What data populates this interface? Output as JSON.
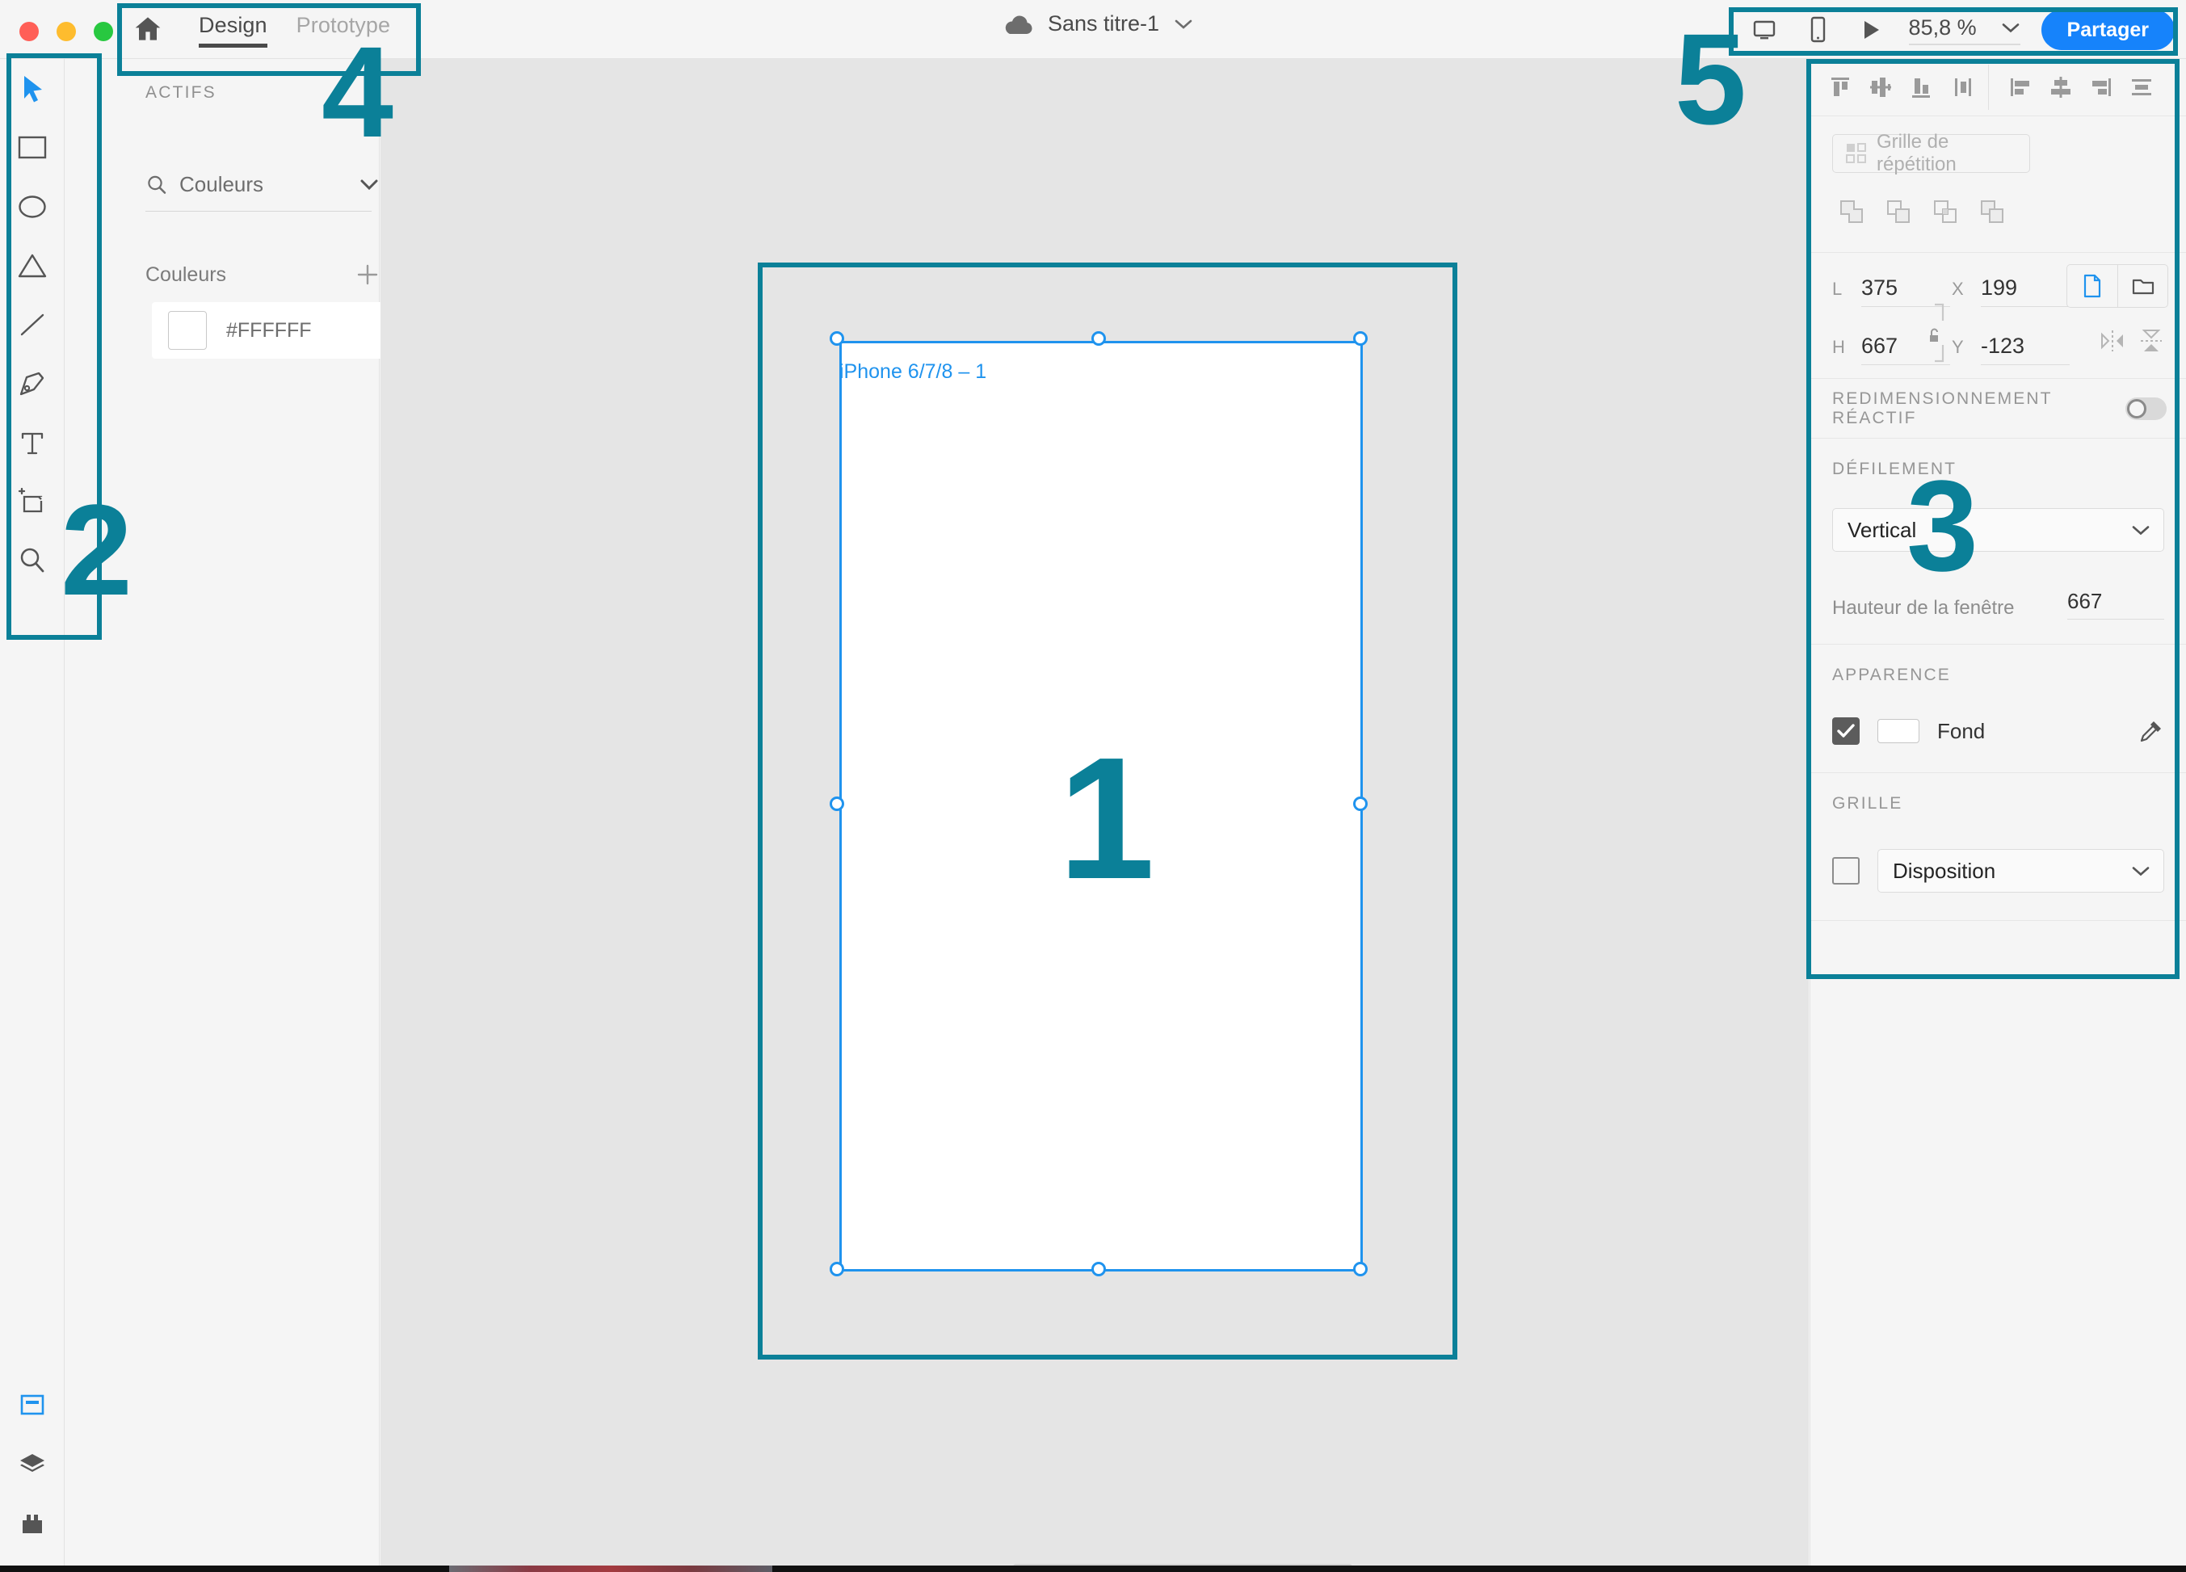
{
  "window": {
    "traffic_lights": [
      "close",
      "minimize",
      "zoom"
    ]
  },
  "topbar": {
    "home_icon": "home-icon",
    "tabs": [
      {
        "label": "Design",
        "active": true
      },
      {
        "label": "Prototype",
        "active": false
      }
    ],
    "document": {
      "cloud_icon": "cloud-icon",
      "title": "Sans titre-1",
      "chevron_icon": "chevron-down-icon"
    },
    "right_controls": {
      "desktop_preview_icon": "desktop-preview-icon",
      "mobile_preview_icon": "mobile-preview-icon",
      "play_icon": "play-icon",
      "zoom_value": "85,8 %",
      "zoom_chevron_icon": "chevron-down-icon",
      "share_label": "Partager"
    }
  },
  "left_toolbar": {
    "tools": [
      {
        "name": "select-tool",
        "icon": "cursor-icon",
        "active": true
      },
      {
        "name": "rectangle-tool",
        "icon": "rectangle-icon",
        "active": false
      },
      {
        "name": "ellipse-tool",
        "icon": "ellipse-icon",
        "active": false
      },
      {
        "name": "polygon-tool",
        "icon": "triangle-icon",
        "active": false
      },
      {
        "name": "line-tool",
        "icon": "line-icon",
        "active": false
      },
      {
        "name": "pen-tool",
        "icon": "pen-icon",
        "active": false
      },
      {
        "name": "text-tool",
        "icon": "text-icon",
        "active": false
      },
      {
        "name": "artboard-tool",
        "icon": "artboard-icon",
        "active": false
      },
      {
        "name": "zoom-tool",
        "icon": "magnifier-icon",
        "active": false
      }
    ],
    "bottom_tools": [
      {
        "name": "assets-panel-toggle",
        "icon": "assets-panel-icon",
        "active": true
      },
      {
        "name": "layers-panel-toggle",
        "icon": "layers-icon",
        "active": false
      },
      {
        "name": "plugins-panel-toggle",
        "icon": "plugin-icon",
        "active": false
      }
    ]
  },
  "assets_panel": {
    "title": "ACTIFS",
    "search": {
      "icon": "search-icon",
      "value": "Couleurs",
      "chevron_icon": "chevron-down-icon"
    },
    "grid_view_icon": "grid-view-icon",
    "colors_section": {
      "label": "Couleurs",
      "add_icon": "plus-icon",
      "items": [
        {
          "swatch": "#FFFFFF",
          "label": "#FFFFFF"
        }
      ]
    }
  },
  "canvas": {
    "artboard_label": "iPhone 6/7/8 – 1",
    "selection_color": "#1f93ee",
    "background": "#e5e5e5",
    "artboard_fill": "#ffffff"
  },
  "right_panel": {
    "align_buttons": [
      "align-top-icon",
      "align-vertical-center-icon",
      "align-bottom-icon",
      "distribute-vertical-icon",
      "align-left-icon",
      "align-horizontal-center-icon",
      "align-right-icon",
      "distribute-horizontal-icon"
    ],
    "repeat_grid": {
      "icon": "repeat-grid-icon",
      "label": "Grille de répétition"
    },
    "boolean_buttons": [
      "boolean-add-icon",
      "boolean-subtract-icon",
      "boolean-intersect-icon",
      "boolean-exclude-icon"
    ],
    "dimensions": {
      "width_label": "L",
      "width_value": "375",
      "height_label": "H",
      "height_value": "667",
      "x_label": "X",
      "x_value": "199",
      "y_label": "Y",
      "y_value": "-123",
      "lock_icon": "unlocked-icon",
      "fit_buttons": [
        "fit-to-artboard-icon",
        "fit-to-content-icon"
      ],
      "flip_buttons": [
        "flip-horizontal-icon",
        "flip-vertical-icon"
      ]
    },
    "responsive_resize": {
      "label": "REDIMENSIONNEMENT RÉACTIF",
      "enabled": false
    },
    "scrolling": {
      "label": "DÉFILEMENT",
      "selected": "Vertical",
      "chevron_icon": "chevron-down-icon",
      "window_height_label": "Hauteur de la fenêtre",
      "window_height_value": "667"
    },
    "appearance": {
      "label": "APPARENCE",
      "fill_checked": true,
      "fill_swatch": "#FFFFFF",
      "fill_label": "Fond",
      "eyedropper_icon": "eyedropper-icon"
    },
    "grid": {
      "label": "GRILLE",
      "enabled": false,
      "selected": "Disposition",
      "chevron_icon": "chevron-down-icon"
    }
  },
  "annotations": {
    "color": "#0b8098",
    "markers": [
      {
        "id": "1",
        "target": "canvas-artboard"
      },
      {
        "id": "2",
        "target": "left-toolbar"
      },
      {
        "id": "3",
        "target": "right-property-panel"
      },
      {
        "id": "4",
        "target": "design-prototype-tabs"
      },
      {
        "id": "5",
        "target": "top-right-controls"
      }
    ]
  }
}
